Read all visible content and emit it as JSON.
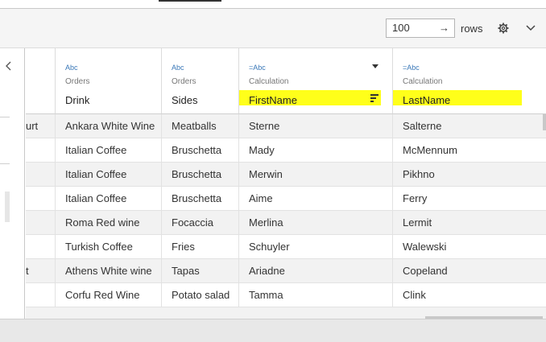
{
  "toolbar": {
    "rows_value": "100",
    "rows_label": "rows",
    "enter_glyph": "→",
    "icons": {
      "settings": "gear-icon",
      "menu": "chevron-down-icon",
      "enter": "arrow-right-icon",
      "back": "chevron-left-icon"
    }
  },
  "columns": [
    {
      "type": "Abc",
      "source": "Orders",
      "name": "Drink"
    },
    {
      "type": "Abc",
      "source": "Orders",
      "name": "Sides"
    },
    {
      "type": "=Abc",
      "source": "Calculation",
      "name": "FirstName",
      "highlighted": true,
      "has_menu": true,
      "sorted": true
    },
    {
      "type": "=Abc",
      "source": "Calculation",
      "name": "LastName",
      "highlighted": true
    }
  ],
  "rows": [
    {
      "c0": "urt",
      "drink": "Ankara White Wine",
      "sides": "Meatballs",
      "first": "Sterne",
      "last": "Salterne"
    },
    {
      "c0": "",
      "drink": "Italian Coffee",
      "sides": "Bruschetta",
      "first": "Mady",
      "last": "McMennum"
    },
    {
      "c0": "",
      "drink": "Italian Coffee",
      "sides": "Bruschetta",
      "first": "Merwin",
      "last": "Pikhno"
    },
    {
      "c0": "",
      "drink": "Italian Coffee",
      "sides": "Bruschetta",
      "first": "Aime",
      "last": "Ferry"
    },
    {
      "c0": "",
      "drink": "Roma Red wine",
      "sides": "Focaccia",
      "first": "Merlina",
      "last": "Lermit"
    },
    {
      "c0": "",
      "drink": "Turkish Coffee",
      "sides": "Fries",
      "first": "Schuyler",
      "last": "Walewski"
    },
    {
      "c0": "t",
      "drink": "Athens White wine",
      "sides": "Tapas",
      "first": "Ariadne",
      "last": "Copeland"
    },
    {
      "c0": "",
      "drink": "Corfu Red Wine",
      "sides": "Potato salad",
      "first": "Tamma",
      "last": "Clink"
    }
  ],
  "colors": {
    "highlight": "#ffff1a",
    "accent": "#5a9bd5",
    "type_icon": "#3a78b8"
  }
}
